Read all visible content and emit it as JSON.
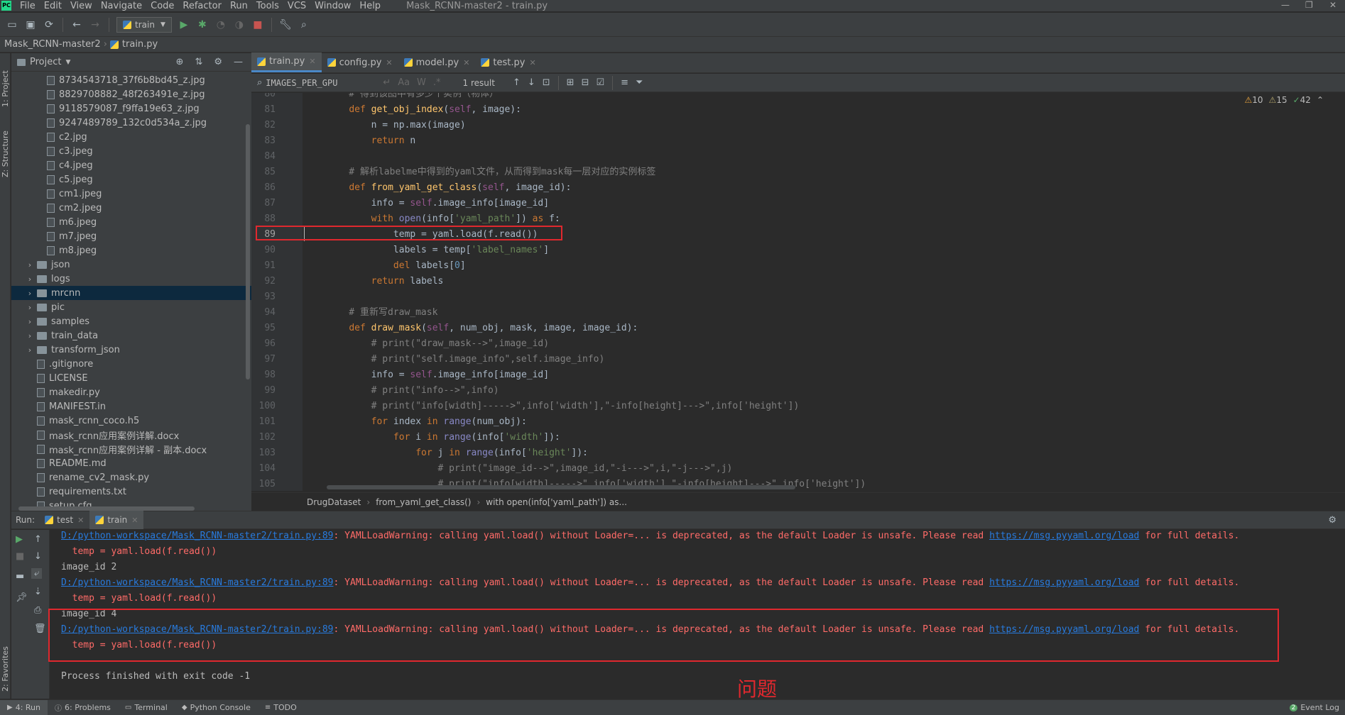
{
  "window": {
    "title": "Mask_RCNN-master2 - train.py",
    "menu": [
      "File",
      "Edit",
      "View",
      "Navigate",
      "Code",
      "Refactor",
      "Run",
      "Tools",
      "VCS",
      "Window",
      "Help"
    ]
  },
  "toolbar": {
    "run_config": "train"
  },
  "navbar": {
    "project": "Mask_RCNN-master2",
    "file": "train.py"
  },
  "stripe": {
    "project_label": "1: Project",
    "structure_label": "Z: Structure",
    "favorites_label": "2: Favorites"
  },
  "project_panel": {
    "title": "Project",
    "items": [
      {
        "label": "8734543718_37f6b8bd45_z.jpg",
        "kind": "file",
        "indent": 1
      },
      {
        "label": "8829708882_48f263491e_z.jpg",
        "kind": "file",
        "indent": 1
      },
      {
        "label": "9118579087_f9ffa19e63_z.jpg",
        "kind": "file",
        "indent": 1
      },
      {
        "label": "9247489789_132c0d534a_z.jpg",
        "kind": "file",
        "indent": 1
      },
      {
        "label": "c2.jpg",
        "kind": "file",
        "indent": 1
      },
      {
        "label": "c3.jpeg",
        "kind": "file",
        "indent": 1
      },
      {
        "label": "c4.jpeg",
        "kind": "file",
        "indent": 1
      },
      {
        "label": "c5.jpeg",
        "kind": "file",
        "indent": 1
      },
      {
        "label": "cm1.jpeg",
        "kind": "file",
        "indent": 1
      },
      {
        "label": "cm2.jpeg",
        "kind": "file",
        "indent": 1
      },
      {
        "label": "m6.jpeg",
        "kind": "file",
        "indent": 1
      },
      {
        "label": "m7.jpeg",
        "kind": "file",
        "indent": 1
      },
      {
        "label": "m8.jpeg",
        "kind": "file",
        "indent": 1
      },
      {
        "label": "json",
        "kind": "folder",
        "indent": 0
      },
      {
        "label": "logs",
        "kind": "folder",
        "indent": 0
      },
      {
        "label": "mrcnn",
        "kind": "folder",
        "indent": 0,
        "selected": true
      },
      {
        "label": "pic",
        "kind": "folder",
        "indent": 0
      },
      {
        "label": "samples",
        "kind": "folder",
        "indent": 0
      },
      {
        "label": "train_data",
        "kind": "folder",
        "indent": 0
      },
      {
        "label": "transform_json",
        "kind": "folder",
        "indent": 0
      },
      {
        "label": ".gitignore",
        "kind": "file",
        "indent": 0
      },
      {
        "label": "LICENSE",
        "kind": "file",
        "indent": 0
      },
      {
        "label": "makedir.py",
        "kind": "file",
        "indent": 0
      },
      {
        "label": "MANIFEST.in",
        "kind": "file",
        "indent": 0
      },
      {
        "label": "mask_rcnn_coco.h5",
        "kind": "file",
        "indent": 0
      },
      {
        "label": "mask_rcnn应用案例详解.docx",
        "kind": "file",
        "indent": 0
      },
      {
        "label": "mask_rcnn应用案例详解 - 副本.docx",
        "kind": "file",
        "indent": 0
      },
      {
        "label": "README.md",
        "kind": "file",
        "indent": 0
      },
      {
        "label": "rename_cv2_mask.py",
        "kind": "file",
        "indent": 0
      },
      {
        "label": "requirements.txt",
        "kind": "file",
        "indent": 0
      },
      {
        "label": "setup.cfg",
        "kind": "file",
        "indent": 0
      }
    ]
  },
  "editor_tabs": [
    {
      "label": "train.py",
      "active": true
    },
    {
      "label": "config.py",
      "active": false
    },
    {
      "label": "model.py",
      "active": false
    },
    {
      "label": "test.py",
      "active": false
    }
  ],
  "findbar": {
    "query": "IMAGES_PER_GPU",
    "result": "1 result",
    "options": [
      "Aa",
      "W",
      ".*"
    ]
  },
  "inspection": {
    "errors": "10",
    "warnings": "15",
    "ok": "42"
  },
  "code_lines": [
    {
      "n": "80",
      "html": "<span class=\"cmt\">    # 得到该图中有多少个实例（物体）</span>"
    },
    {
      "n": "81",
      "html": "    <span class=\"kw\">def</span> <span class=\"fn\">get_obj_index</span>(<span class=\"self\">self</span>, image):"
    },
    {
      "n": "82",
      "html": "        n = np.max(image)"
    },
    {
      "n": "83",
      "html": "        <span class=\"kw\">return</span> n"
    },
    {
      "n": "84",
      "html": ""
    },
    {
      "n": "85",
      "html": "<span class=\"cmt\">    # 解析labelme中得到的yaml文件，从而得到mask每一层对应的实例标签</span>"
    },
    {
      "n": "86",
      "html": "    <span class=\"kw\">def</span> <span class=\"fn\">from_yaml_get_class</span>(<span class=\"self\">self</span>, image_id):"
    },
    {
      "n": "87",
      "html": "        info = <span class=\"self\">self</span>.image_info[image_id]"
    },
    {
      "n": "88",
      "html": "        <span class=\"kw\">with</span> <span class=\"bi\">open</span>(info[<span class=\"str\">'yaml_path'</span>]) <span class=\"kw\">as</span> f:"
    },
    {
      "n": "89",
      "html": "            temp = yaml.load(f.read())"
    },
    {
      "n": "90",
      "html": "            labels = temp[<span class=\"str\">'label_names'</span>]"
    },
    {
      "n": "91",
      "html": "            <span class=\"kw\">del</span> labels[<span class=\"num\">0</span>]"
    },
    {
      "n": "92",
      "html": "        <span class=\"kw\">return</span> labels"
    },
    {
      "n": "93",
      "html": ""
    },
    {
      "n": "94",
      "html": "<span class=\"cmt\">    # 重新写draw_mask</span>"
    },
    {
      "n": "95",
      "html": "    <span class=\"kw\">def</span> <span class=\"fn\">draw_mask</span>(<span class=\"self\">self</span>, num_obj, mask, image, image_id):"
    },
    {
      "n": "96",
      "html": "<span class=\"cmt\">        # print(\"draw_mask-->\",image_id)</span>"
    },
    {
      "n": "97",
      "html": "<span class=\"cmt\">        # print(\"self.image_info\",self.image_info)</span>"
    },
    {
      "n": "98",
      "html": "        info = <span class=\"self\">self</span>.image_info[image_id]"
    },
    {
      "n": "99",
      "html": "<span class=\"cmt\">        # print(\"info-->\",info)</span>"
    },
    {
      "n": "100",
      "html": "<span class=\"cmt\">        # print(\"info[width]----->\",info['width'],\"-info[height]--->\",info['height'])</span>"
    },
    {
      "n": "101",
      "html": "        <span class=\"kw\">for</span> index <span class=\"kw\">in</span> <span class=\"bi\">range</span>(num_obj):"
    },
    {
      "n": "102",
      "html": "            <span class=\"kw\">for</span> i <span class=\"kw\">in</span> <span class=\"bi\">range</span>(info[<span class=\"str\">'width'</span>]):"
    },
    {
      "n": "103",
      "html": "                <span class=\"kw\">for</span> j <span class=\"kw\">in</span> <span class=\"bi\">range</span>(info[<span class=\"str\">'height'</span>]):"
    },
    {
      "n": "104",
      "html": "<span class=\"cmt\">                    # print(\"image_id-->\",image_id,\"-i--->\",i,\"-j--->\",j)</span>"
    },
    {
      "n": "105",
      "html": "<span class=\"cmt\">                    # print(\"info[width]----->\",info['width'],\"-info[height]--->\",info['height'])</span>"
    }
  ],
  "editor_crumbs": [
    "DrugDataset",
    "from_yaml_get_class()",
    "with open(info['yaml_path']) as..."
  ],
  "run_panel": {
    "label": "Run:",
    "tabs": [
      {
        "label": "test"
      },
      {
        "label": "train"
      }
    ]
  },
  "console": {
    "lines": [
      {
        "link": "D:/python-workspace/Mask_RCNN-master2/train.py:89",
        "warn": ": YAMLLoadWarning: calling yaml.load() without Loader=... is deprecated, as the default Loader is unsafe. Please read ",
        "url": "https://msg.pyyaml.org/load",
        "tail": " for full details."
      },
      {
        "text": "  temp = yaml.load(f.read())",
        "cls": "cwarn"
      },
      {
        "text": "image_id 2",
        "cls": ""
      },
      {
        "link": "D:/python-workspace/Mask_RCNN-master2/train.py:89",
        "warn": ": YAMLLoadWarning: calling yaml.load() without Loader=... is deprecated, as the default Loader is unsafe. Please read ",
        "url": "https://msg.pyyaml.org/load",
        "tail": " for full details."
      },
      {
        "text": "  temp = yaml.load(f.read())",
        "cls": "cwarn"
      },
      {
        "text": "image_id 4",
        "cls": ""
      },
      {
        "link": "D:/python-workspace/Mask_RCNN-master2/train.py:89",
        "warn": ": YAMLLoadWarning: calling yaml.load() without Loader=... is deprecated, as the default Loader is unsafe. Please read ",
        "url": "https://msg.pyyaml.org/load",
        "tail": " for full details."
      },
      {
        "text": "  temp = yaml.load(f.read())",
        "cls": "cwarn"
      },
      {
        "text": "",
        "cls": ""
      },
      {
        "text": "Process finished with exit code -1",
        "cls": ""
      }
    ],
    "annotation": "问题"
  },
  "bottom_bar": {
    "items": [
      "4: Run",
      "6: Problems",
      "Terminal",
      "Python Console",
      "TODO"
    ],
    "event_log": "Event Log",
    "event_count": "2"
  },
  "colors": {
    "accent": "#4a88c7",
    "highlight_box": "#e0282e"
  }
}
